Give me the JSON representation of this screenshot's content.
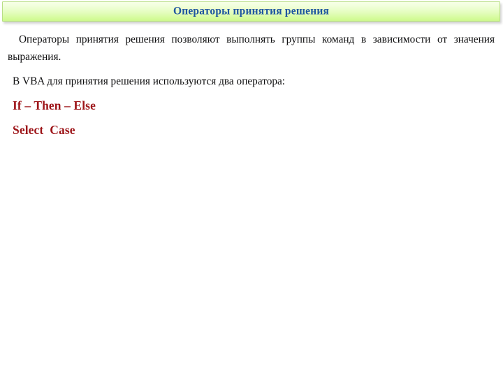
{
  "slide": {
    "title": "Операторы принятия решения",
    "title_color": "#1f56a0",
    "banner_gradient_top": "#f7ffe7",
    "banner_gradient_bottom": "#cdf78d",
    "banner_border_color": "#b9df86",
    "background_color": "#ffffff",
    "body": {
      "paragraph_1": "Операторы принятия решения позволяют выполнять группы команд в зависимости от значения выражения.",
      "paragraph_2": "В VBA для принятия решения используются два оператора:",
      "keyword_color": "#9d1519",
      "keywords": [
        "If – Then – Else",
        "Select  Case"
      ]
    }
  }
}
